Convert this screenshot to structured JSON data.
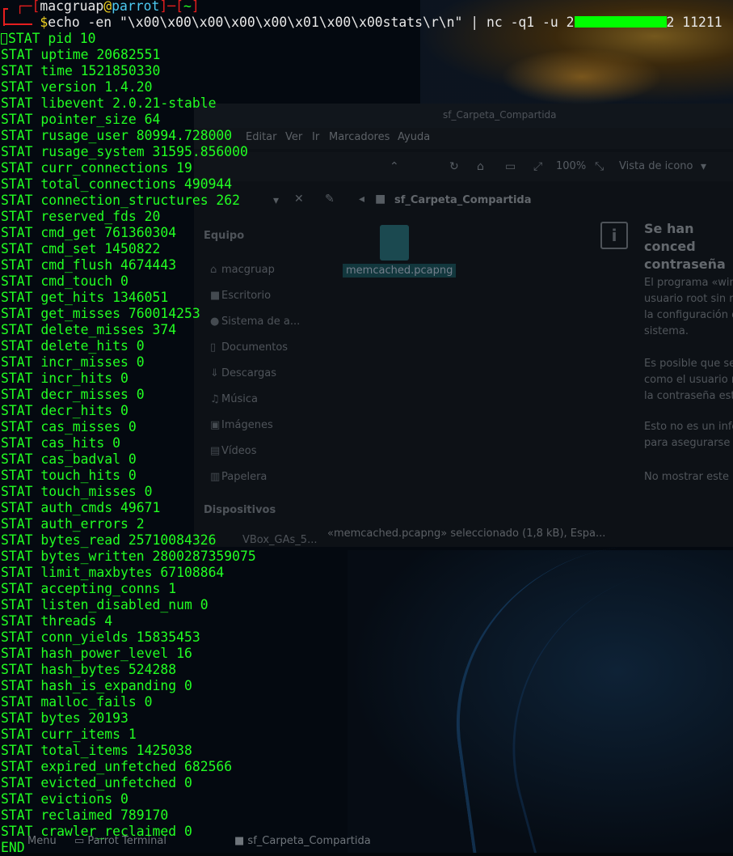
{
  "desktop": {
    "filemanager": {
      "title": "sf_Carpeta_Compartida",
      "menu": [
        "Editar",
        "Ver",
        "Ir",
        "Marcadores",
        "Ayuda"
      ],
      "zoom": "100%",
      "view_mode": "Vista de icono",
      "path": "sf_Carpeta_Compartida",
      "sidebar_group_1": "Equipo",
      "sidebar_items": [
        "macgruap",
        "Escritorio",
        "Sistema de a...",
        "Documentos",
        "Descargas",
        "Música",
        "Imágenes",
        "Vídeos",
        "Papelera"
      ],
      "sidebar_group_2": "Dispositivos",
      "device_item": "VBox_GAs_5...",
      "file_name": "memcached.pcapng",
      "dialog_title_1": "Se han conced",
      "dialog_title_2": "contraseña",
      "dialog_lines_1": [
        "El programa «win",
        "usuario root sin n",
        "la configuración d",
        "sistema."
      ],
      "dialog_lines_2": [
        "Es posible que se",
        "como el usuario r",
        "la contraseña est"
      ],
      "dialog_lines_3": [
        "Esto no es un info",
        "para asegurarse c"
      ],
      "dialog_line_4": "No mostrar este",
      "status_text": "«memcached.pcapng» seleccionado (1,8 kB), Espa..."
    },
    "panel": {
      "menu_label": "Menu",
      "terminal_task": "Parrot Terminal",
      "folder_task": "sf_Carpeta_Compartida"
    }
  },
  "terminal": {
    "prompt": {
      "user": "macgruap",
      "at": "@",
      "host": "parrot",
      "dir": "~"
    },
    "command_prefix": "echo -en \"\\x00\\x00\\x00\\x00\\x00\\x01\\x00\\x00stats\\r\\n\" | nc -q1 -u 2",
    "command_suffix": "2 11211",
    "first_output": "STAT pid 10",
    "output": [
      "STAT uptime 20682551",
      "STAT time 1521850330",
      "STAT version 1.4.20",
      "STAT libevent 2.0.21-stable",
      "STAT pointer_size 64",
      "STAT rusage_user 80994.728000",
      "STAT rusage_system 31595.856000",
      "STAT curr_connections 19",
      "STAT total_connections 490944",
      "STAT connection_structures 262",
      "STAT reserved_fds 20",
      "STAT cmd_get 761360304",
      "STAT cmd_set 1450822",
      "STAT cmd_flush 4674443",
      "STAT cmd_touch 0",
      "STAT get_hits 1346051",
      "STAT get_misses 760014253",
      "STAT delete_misses 374",
      "STAT delete_hits 0",
      "STAT incr_misses 0",
      "STAT incr_hits 0",
      "STAT decr_misses 0",
      "STAT decr_hits 0",
      "STAT cas_misses 0",
      "STAT cas_hits 0",
      "STAT cas_badval 0",
      "STAT touch_hits 0",
      "STAT touch_misses 0",
      "STAT auth_cmds 49671",
      "STAT auth_errors 2",
      "STAT bytes_read 25710084326",
      "STAT bytes_written 2800287359075",
      "STAT limit_maxbytes 67108864",
      "STAT accepting_conns 1",
      "STAT listen_disabled_num 0",
      "STAT threads 4",
      "STAT conn_yields 15835453",
      "STAT hash_power_level 16",
      "STAT hash_bytes 524288",
      "STAT hash_is_expanding 0",
      "STAT malloc_fails 0",
      "STAT bytes 20193",
      "STAT curr_items 1",
      "STAT total_items 1425038",
      "STAT expired_unfetched 682566",
      "STAT evicted_unfetched 0",
      "STAT evictions 0",
      "STAT reclaimed 789170",
      "STAT crawler_reclaimed 0",
      "END"
    ]
  },
  "colors": {
    "terminal_text": "#22ff22",
    "prompt_bracket": "#e61e1e",
    "prompt_host": "#4cc9f0",
    "prompt_at": "#f0d220",
    "redaction": "#00ff00"
  }
}
